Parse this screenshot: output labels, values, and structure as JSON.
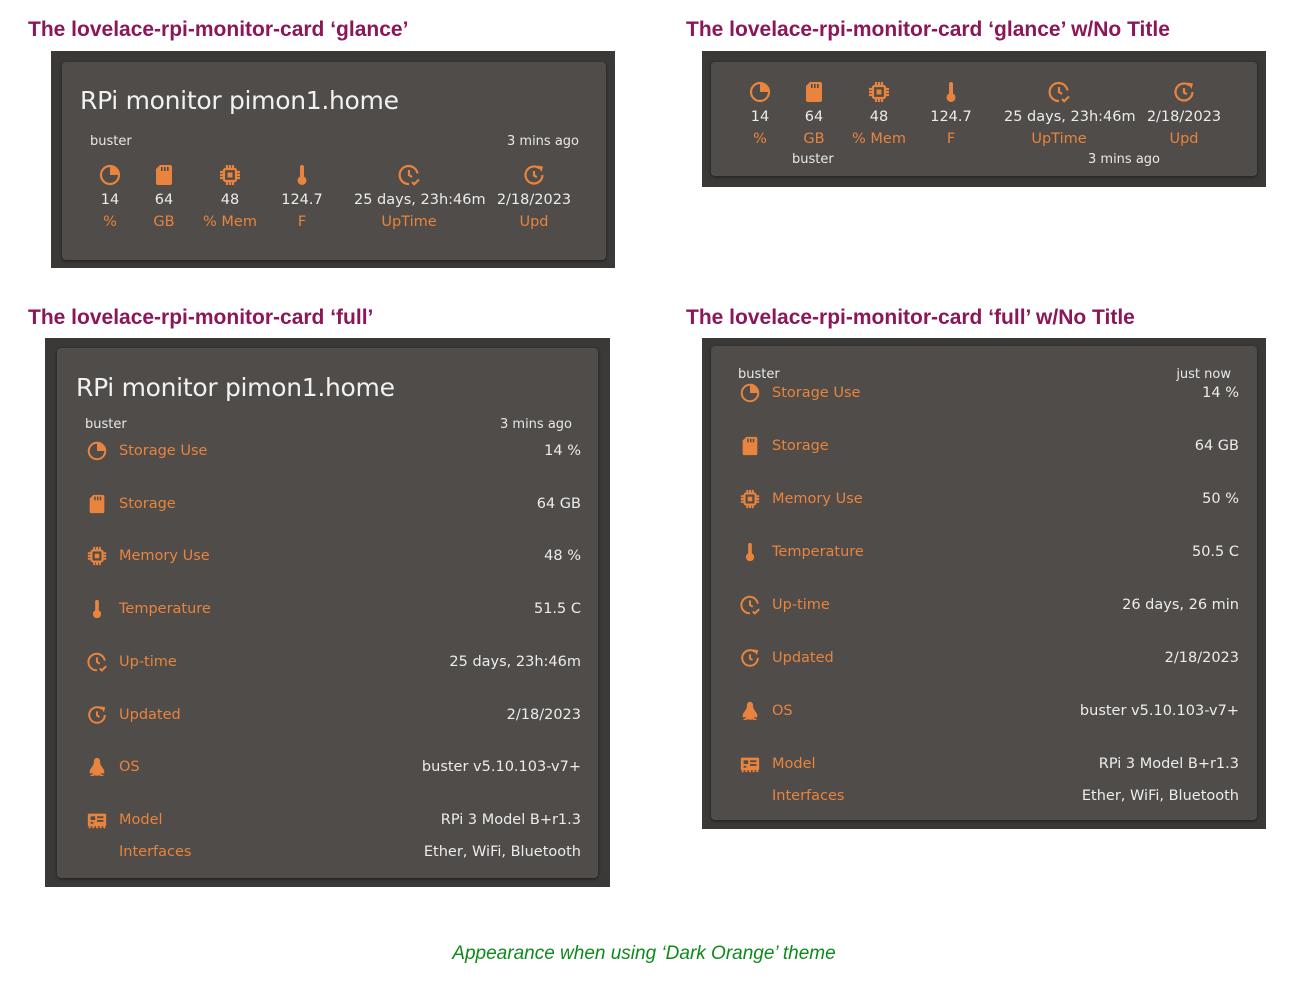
{
  "headings": {
    "glance": "The lovelace-rpi-monitor-card ‘glance’",
    "glance_no_title": "The lovelace-rpi-monitor-card ‘glance’ w/No Title",
    "full": "The lovelace-rpi-monitor-card ‘full’",
    "full_no_title": "The lovelace-rpi-monitor-card ‘full’ w/No Title"
  },
  "card_title": "RPi monitor pimon1.home",
  "glance_card": {
    "os": "buster",
    "updated": "3 mins ago",
    "items": [
      {
        "icon": "storage-pie-icon",
        "value": "14",
        "unit": "%"
      },
      {
        "icon": "sd-card-icon",
        "value": "64",
        "unit": "GB"
      },
      {
        "icon": "chip-icon",
        "value": "48",
        "unit": "% Mem"
      },
      {
        "icon": "thermometer-icon",
        "value": "124.7",
        "unit": "F"
      },
      {
        "icon": "clock-check-icon",
        "value": "25 days, 23h:46m",
        "unit": "UpTime"
      },
      {
        "icon": "refresh-clock-icon",
        "value": "2/18/2023",
        "unit": "Upd"
      }
    ]
  },
  "glance_no_title_card": {
    "os": "buster",
    "updated": "3 mins ago",
    "items": [
      {
        "icon": "storage-pie-icon",
        "value": "14",
        "unit": "%"
      },
      {
        "icon": "sd-card-icon",
        "value": "64",
        "unit": "GB"
      },
      {
        "icon": "chip-icon",
        "value": "48",
        "unit": "% Mem"
      },
      {
        "icon": "thermometer-icon",
        "value": "124.7",
        "unit": "F"
      },
      {
        "icon": "clock-check-icon",
        "value": "25 days, 23h:46m",
        "unit": "UpTime"
      },
      {
        "icon": "refresh-clock-icon",
        "value": "2/18/2023",
        "unit": "Upd"
      }
    ]
  },
  "full_card": {
    "os": "buster",
    "updated": "3 mins ago",
    "rows": [
      {
        "icon": "storage-pie-icon",
        "label": "Storage Use",
        "value": "14 %"
      },
      {
        "icon": "sd-card-icon",
        "label": "Storage",
        "value": "64 GB"
      },
      {
        "icon": "chip-icon",
        "label": "Memory Use",
        "value": "48 %"
      },
      {
        "icon": "thermometer-icon",
        "label": "Temperature",
        "value": "51.5 C"
      },
      {
        "icon": "clock-check-icon",
        "label": "Up-time",
        "value": "25 days, 23h:46m"
      },
      {
        "icon": "refresh-clock-icon",
        "label": "Updated",
        "value": "2/18/2023"
      },
      {
        "icon": "linux-penguin-icon",
        "label": "OS",
        "value": "buster v5.10.103-v7+"
      },
      {
        "icon": "board-icon",
        "label": "Model",
        "value": "RPi 3 Model B+r1.3"
      },
      {
        "icon": "",
        "label": "Interfaces",
        "value": "Ether, WiFi, Bluetooth"
      }
    ]
  },
  "full_no_title_card": {
    "os": "buster",
    "updated": "just now",
    "rows": [
      {
        "icon": "storage-pie-icon",
        "label": "Storage Use",
        "value": "14 %"
      },
      {
        "icon": "sd-card-icon",
        "label": "Storage",
        "value": "64 GB"
      },
      {
        "icon": "chip-icon",
        "label": "Memory Use",
        "value": "50 %"
      },
      {
        "icon": "thermometer-icon",
        "label": "Temperature",
        "value": "50.5 C"
      },
      {
        "icon": "clock-check-icon",
        "label": "Up-time",
        "value": "26 days, 26 min"
      },
      {
        "icon": "refresh-clock-icon",
        "label": "Updated",
        "value": "2/18/2023"
      },
      {
        "icon": "linux-penguin-icon",
        "label": "OS",
        "value": "buster v5.10.103-v7+"
      },
      {
        "icon": "board-icon",
        "label": "Model",
        "value": "RPi 3 Model B+r1.3"
      },
      {
        "icon": "",
        "label": "Interfaces",
        "value": "Ether, WiFi, Bluetooth"
      }
    ]
  },
  "caption": "Appearance when using ‘Dark Orange’ theme",
  "colors": {
    "heading": "#8b1759",
    "card_bg": "#4f4c49",
    "accent": "#e8843e",
    "caption": "#0e8a1a"
  }
}
